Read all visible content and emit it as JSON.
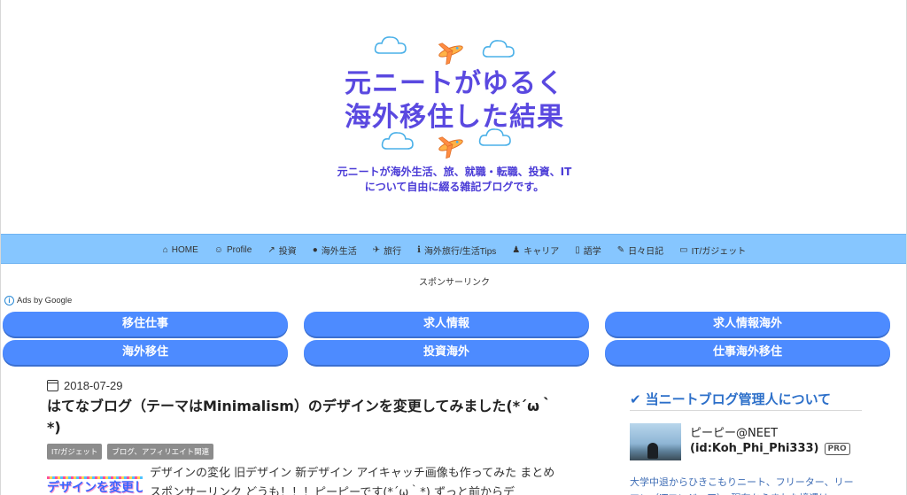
{
  "header": {
    "title_line1": "元ニートがゆるく",
    "title_line2": "海外移住した結果",
    "subtitle_line1": "元ニートが海外生活、旅、就職・転職、投資、IT",
    "subtitle_line2": "について自由に綴る雑記ブログです。"
  },
  "nav": {
    "items": [
      {
        "icon": "home-icon",
        "label": "HOME"
      },
      {
        "icon": "profile-icon",
        "label": "Profile"
      },
      {
        "icon": "chart-icon",
        "label": "投資"
      },
      {
        "icon": "globe-icon",
        "label": "海外生活"
      },
      {
        "icon": "plane-icon",
        "label": "旅行"
      },
      {
        "icon": "info-icon",
        "label": "海外旅行/生活Tips"
      },
      {
        "icon": "person-icon",
        "label": "キャリア"
      },
      {
        "icon": "book-icon",
        "label": "語学"
      },
      {
        "icon": "edit-icon",
        "label": "日々日記"
      },
      {
        "icon": "laptop-icon",
        "label": "IT/ガジェット"
      }
    ]
  },
  "sponsor_label": "スポンサーリンク",
  "ads": {
    "label": "Ads by Google",
    "buttons": [
      "移住仕事",
      "求人情報",
      "求人情報海外",
      "海外移住",
      "投資海外",
      "仕事海外移住"
    ]
  },
  "post": {
    "date": "2018-07-29",
    "title": "はてなブログ（テーマはMinimalism）のデザインを変更してみました(*´ω｀*)",
    "tags": [
      "IT/ガジェット",
      "ブログ、アフィリエイト関連"
    ],
    "thumbnail_text": "デザインを変更し",
    "excerpt": "デザインの変化 旧デザイン 新デザイン アイキャッチ画像も作ってみた まとめ スポンサーリンク どうも！！！ピーピーです(*´ω｀*) ずっと前からデ"
  },
  "sidebar": {
    "title": "当ニートブログ管理人について",
    "name": "ピーピー@NEET",
    "id": "(id:Koh_Phi_Phi333)",
    "pro": "PRO",
    "desc": "大学中退からひきこもりニート、フリーター、リーマン（ITエンジニア）、現在からまれた境遇は"
  },
  "colors": {
    "nav_bg": "#86c6ff",
    "ad_button": "#4d8bff",
    "title_purple": "#5a49e0",
    "sidebar_blue": "#2c6fc9"
  }
}
